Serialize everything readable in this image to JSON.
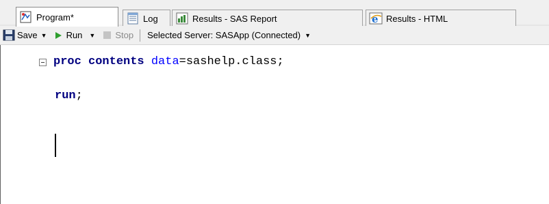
{
  "tabs": [
    {
      "label": "Program*",
      "icon": "program-icon",
      "active": true
    },
    {
      "label": "Log",
      "icon": "log-icon",
      "active": false
    },
    {
      "label": "Results - SAS Report",
      "icon": "sas-report-icon",
      "active": false
    },
    {
      "label": "Results - HTML",
      "icon": "ie-icon",
      "active": false
    }
  ],
  "toolbar": {
    "save_label": "Save",
    "run_label": "Run",
    "stop_label": "Stop",
    "server_label": "Selected Server: SASApp (Connected)"
  },
  "code": {
    "line1_kw1": "proc",
    "line1_kw2": "contents",
    "line1_attr": "data",
    "line1_rest": "=sashelp.class;",
    "line2_kw": "run",
    "line2_rest": ";"
  },
  "colors": {
    "keyword": "#000080",
    "attribute": "#0000ff",
    "run_green": "#2e9e2e"
  }
}
